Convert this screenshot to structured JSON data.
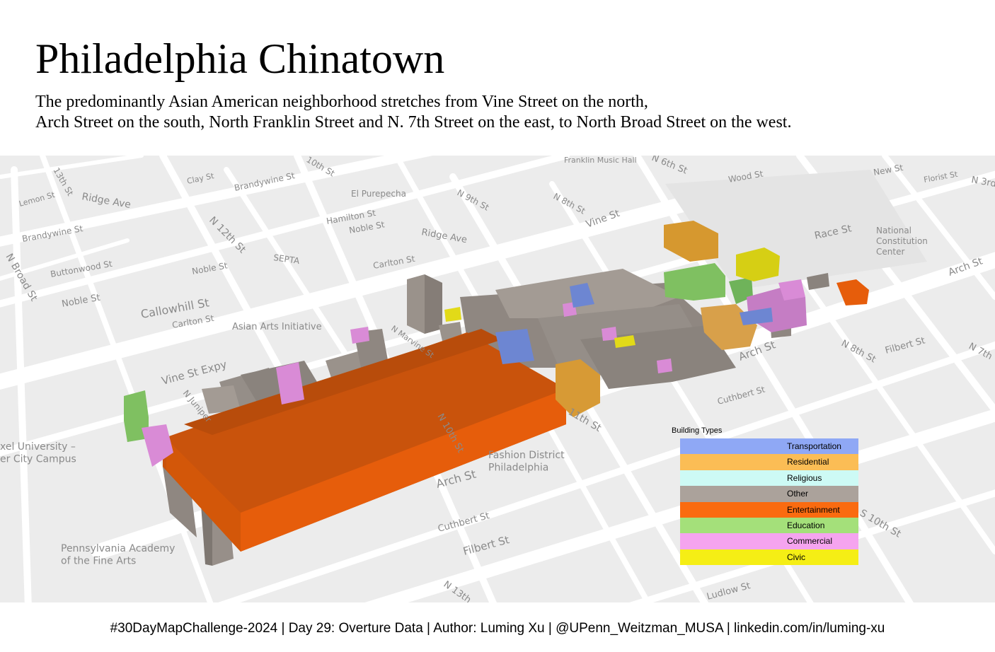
{
  "title": "Philadelphia Chinatown",
  "subtitle": {
    "line1": "The predominantly Asian American neighborhood stretches from Vine Street on the north,",
    "line2": "Arch Street on the south, North Franklin Street and N. 7th Street on the east, to North Broad Street on the west."
  },
  "map": {
    "labels": [
      {
        "text": "13th St"
      },
      {
        "text": "Lemon St"
      },
      {
        "text": "Ridge Ave"
      },
      {
        "text": "Clay St"
      },
      {
        "text": "Brandywine St"
      },
      {
        "text": "10th St"
      },
      {
        "text": "Franklin Music Hall"
      },
      {
        "text": "N 6th St"
      },
      {
        "text": "Wood St"
      },
      {
        "text": "New St"
      },
      {
        "text": "Florist St"
      },
      {
        "text": "N 3rd"
      },
      {
        "text": "El Purepecha"
      },
      {
        "text": "N 9th St"
      },
      {
        "text": "N 8th St"
      },
      {
        "text": "Hamilton St"
      },
      {
        "text": "Noble St"
      },
      {
        "text": "Ridge Ave"
      },
      {
        "text": "Vine St"
      },
      {
        "text": "Race St"
      },
      {
        "text": "National Constitution Center"
      },
      {
        "text": "Brandywine St"
      },
      {
        "text": "N 12th St"
      },
      {
        "text": "SEPTA"
      },
      {
        "text": "Carlton St"
      },
      {
        "text": "Buttonwood St"
      },
      {
        "text": "Noble St"
      },
      {
        "text": "N Broad St"
      },
      {
        "text": "Noble St"
      },
      {
        "text": "Callowhill St"
      },
      {
        "text": "Carlton St"
      },
      {
        "text": "Asian Arts Initiative"
      },
      {
        "text": "Arch St"
      },
      {
        "text": "N Marvine St"
      },
      {
        "text": "Vine St Expy"
      },
      {
        "text": "N 8th St"
      },
      {
        "text": "Filbert St"
      },
      {
        "text": "N 7th"
      },
      {
        "text": "Arch St"
      },
      {
        "text": "Cuthbert St"
      },
      {
        "text": "11th St"
      },
      {
        "text": "N 10th St"
      },
      {
        "text": "Fashion District Philadelphia"
      },
      {
        "text": "Arch St"
      },
      {
        "text": "Drexel University – Center City Campus"
      },
      {
        "text": "Cuthbert St"
      },
      {
        "text": "Filbert St"
      },
      {
        "text": "Pennsylvania Academy of the Fine Arts"
      },
      {
        "text": "S 10th St"
      },
      {
        "text": "Ludlow St"
      },
      {
        "text": "N 13th"
      },
      {
        "text": "N Juniper"
      }
    ]
  },
  "legend": {
    "title": "Building Types",
    "items": [
      {
        "label": "Transportation",
        "color": "#8fa8f5"
      },
      {
        "label": "Residential",
        "color": "#fbbd55"
      },
      {
        "label": "Religious",
        "color": "#cdfaf5"
      },
      {
        "label": "Other",
        "color": "#aba29b"
      },
      {
        "label": "Entertainment",
        "color": "#fa6b10"
      },
      {
        "label": "Education",
        "color": "#a4e07a"
      },
      {
        "label": "Commercial",
        "color": "#f5a4ef"
      },
      {
        "label": "Civic",
        "color": "#f5ee15"
      }
    ]
  },
  "footer": "#30DayMapChallenge-2024 | Day 29: Overture Data | Author: Luming Xu | @UPenn_Weitzman_MUSA | linkedin.com/in/luming-xu"
}
